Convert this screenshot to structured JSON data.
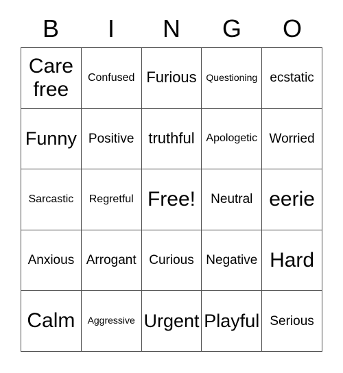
{
  "card": {
    "title": "BINGO",
    "header_letters": [
      "B",
      "I",
      "N",
      "G",
      "O"
    ],
    "grid": {
      "columns": 5,
      "rows": 5,
      "border_color": "#4d4d4d",
      "background_color": "#ffffff",
      "text_color": "#000000"
    },
    "cells": [
      {
        "text": "Care free",
        "size": "xxl",
        "free": false
      },
      {
        "text": "Confused",
        "size": "s",
        "free": false
      },
      {
        "text": "Furious",
        "size": "l",
        "free": false
      },
      {
        "text": "Questioning",
        "size": "xs",
        "free": false
      },
      {
        "text": "ecstatic",
        "size": "m",
        "free": false
      },
      {
        "text": "Funny",
        "size": "xl",
        "free": false
      },
      {
        "text": "Positive",
        "size": "m",
        "free": false
      },
      {
        "text": "truthful",
        "size": "l",
        "free": false
      },
      {
        "text": "Apologetic",
        "size": "s",
        "free": false
      },
      {
        "text": "Worried",
        "size": "m",
        "free": false
      },
      {
        "text": "Sarcastic",
        "size": "s",
        "free": false
      },
      {
        "text": "Regretful",
        "size": "s",
        "free": false
      },
      {
        "text": "Free!",
        "size": "xxl",
        "free": true
      },
      {
        "text": "Neutral",
        "size": "m",
        "free": false
      },
      {
        "text": "eerie",
        "size": "xxl",
        "free": false
      },
      {
        "text": "Anxious",
        "size": "m",
        "free": false
      },
      {
        "text": "Arrogant",
        "size": "m",
        "free": false
      },
      {
        "text": "Curious",
        "size": "m",
        "free": false
      },
      {
        "text": "Negative",
        "size": "m",
        "free": false
      },
      {
        "text": "Hard",
        "size": "xxl",
        "free": false
      },
      {
        "text": "Calm",
        "size": "xxl",
        "free": false
      },
      {
        "text": "Aggressive",
        "size": "xs",
        "free": false
      },
      {
        "text": "Urgent",
        "size": "xl",
        "free": false
      },
      {
        "text": "Playful",
        "size": "xl",
        "free": false
      },
      {
        "text": "Serious",
        "size": "m",
        "free": false
      }
    ]
  }
}
